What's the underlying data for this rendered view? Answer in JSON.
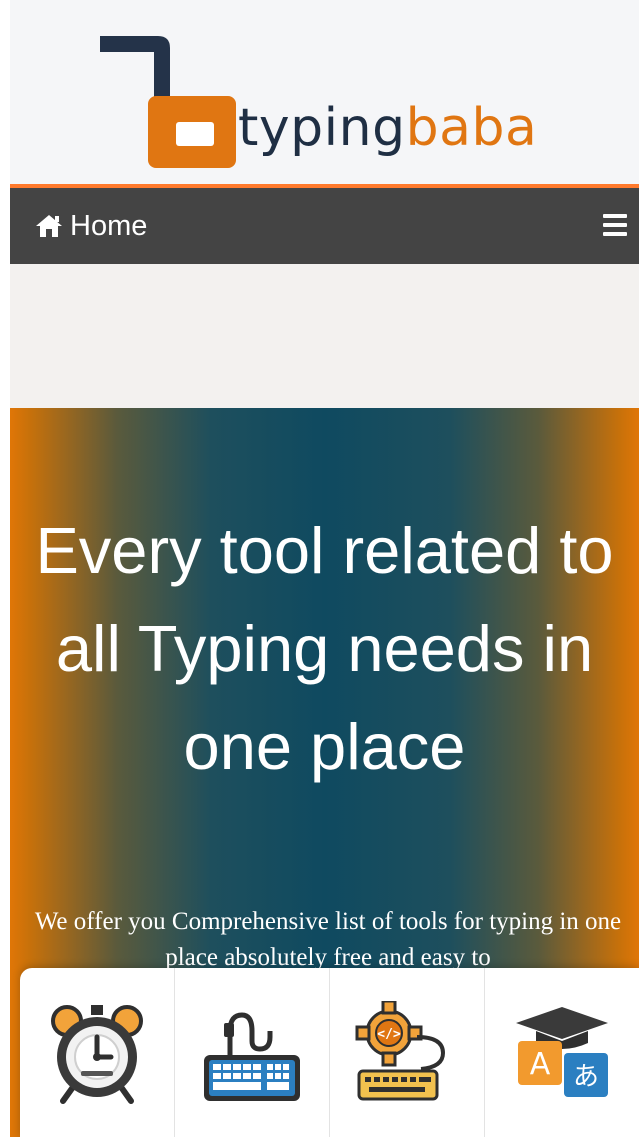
{
  "brand": {
    "name_part1": "typing",
    "name_part2": "baba",
    "colors": {
      "navy": "#1f2f44",
      "orange": "#e07612"
    }
  },
  "nav": {
    "home_label": "Home",
    "home_icon": "home-icon",
    "menu_icon": "hamburger-icon"
  },
  "hero": {
    "title": "Every tool related to all Typing needs in one place",
    "description": "We offer you Comprehensive list of tools for typing in one place absolutely free and easy to"
  },
  "tools": [
    {
      "icon": "alarm-clock-icon"
    },
    {
      "icon": "keyboard-cable-icon"
    },
    {
      "icon": "code-gear-keyboard-icon"
    },
    {
      "icon": "language-translate-icon"
    }
  ]
}
